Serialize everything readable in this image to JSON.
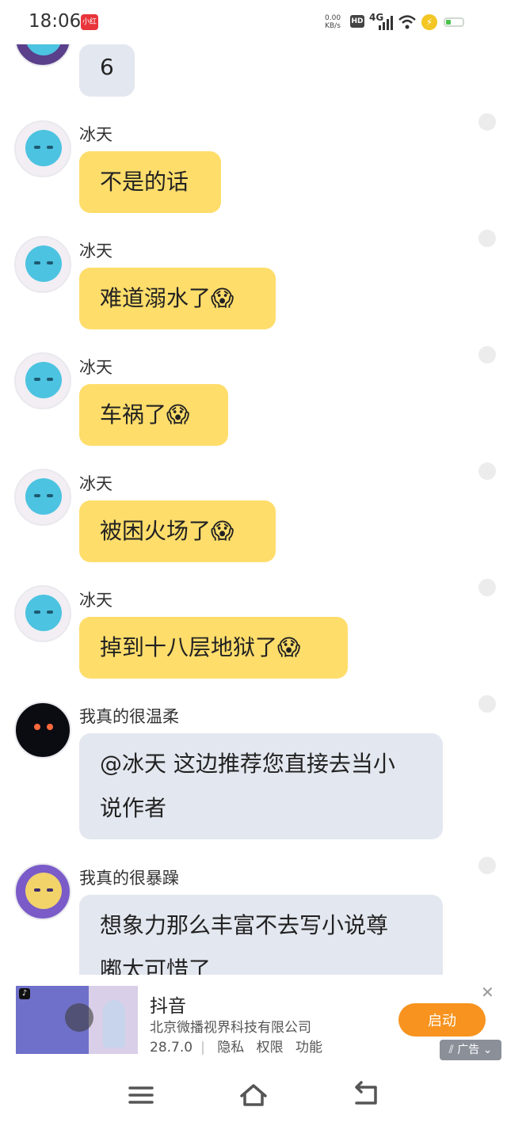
{
  "status_bar": {
    "time": "18:06",
    "app_badge": "小红书",
    "net_speed": "0.00",
    "net_unit": "KB/s",
    "hd": "HD",
    "signal": "4G"
  },
  "messages": [
    {
      "sender": "",
      "text": "6",
      "style": "gray",
      "cut_top": true
    },
    {
      "sender": "冰天",
      "text": "不是的话",
      "emoji": "",
      "style": "yellow"
    },
    {
      "sender": "冰天",
      "text": "难道溺水了",
      "emoji": "😱",
      "style": "yellow"
    },
    {
      "sender": "冰天",
      "text": "车祸了",
      "emoji": "😱",
      "style": "yellow"
    },
    {
      "sender": "冰天",
      "text": "被困火场了",
      "emoji": "😱",
      "style": "yellow"
    },
    {
      "sender": "冰天",
      "text": "掉到十八层地狱了",
      "emoji": "😱",
      "style": "yellow"
    },
    {
      "sender": "我真的很温柔",
      "text_line1": "@冰天 这边推荐您直接去当小",
      "text_line2": "说作者",
      "style": "gray"
    },
    {
      "sender": "我真的很暴躁",
      "text_line1": "想象力那么丰富不去写小说尊",
      "text_line2": "嘟太可惜了",
      "style": "gray"
    }
  ],
  "ad": {
    "title": "抖音",
    "company": "北京微播视界科技有限公司",
    "version": "28.7.0",
    "privacy": "隐私",
    "permissions": "权限",
    "features": "功能",
    "cta": "启动",
    "label": "广告",
    "close": "✕"
  }
}
